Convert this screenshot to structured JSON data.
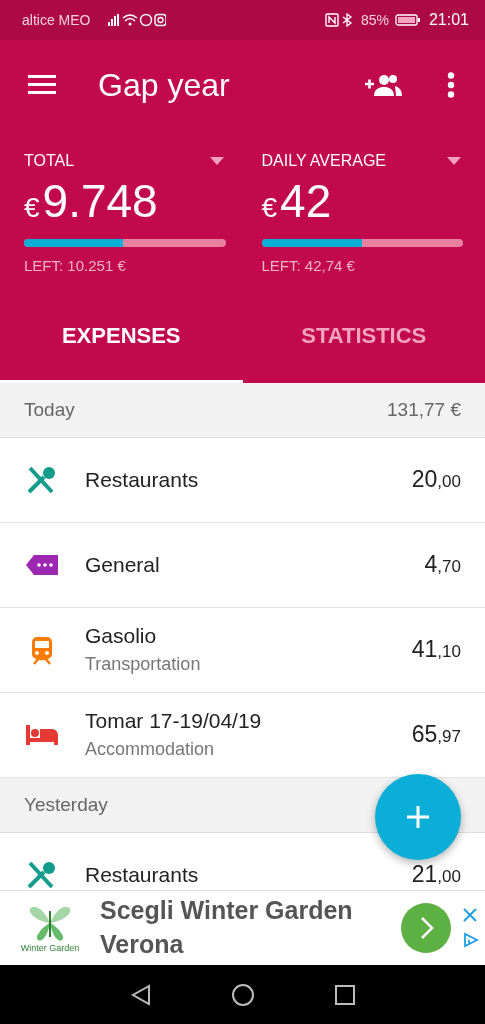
{
  "status_bar": {
    "carrier": "altice MEO",
    "battery": "85%",
    "time": "21:01"
  },
  "toolbar": {
    "title": "Gap year"
  },
  "summary": [
    {
      "label": "TOTAL",
      "currency": "€",
      "value": "9.748",
      "level": 0.49,
      "left": "LEFT: 10.251 €"
    },
    {
      "label": "DAILY AVERAGE",
      "currency": "€",
      "value": "42",
      "level": 0.5,
      "left": "LEFT: 42,74 €"
    }
  ],
  "tabs": [
    {
      "label": "EXPENSES",
      "selected": true
    },
    {
      "label": "STATISTICS",
      "selected": false
    }
  ],
  "sections": [
    {
      "day": "Today",
      "total": "131,77 €",
      "items": [
        {
          "kind": "restaurant",
          "color": "#139c8c",
          "name": "Restaurants",
          "amount": "20",
          "decimals": ",00"
        },
        {
          "kind": "general",
          "color": "#9c27b0",
          "name": "General",
          "amount": "4",
          "decimals": ",70"
        },
        {
          "kind": "transport",
          "color": "#f57c00",
          "name": "Gasolio",
          "category": "Transportation",
          "amount": "41",
          "decimals": ",10"
        },
        {
          "kind": "accommodation",
          "color": "#e53935",
          "name": "Tomar 17-19/04/19",
          "category": "Accommodation",
          "amount": "65",
          "decimals": ",97"
        }
      ]
    },
    {
      "day": "Yesterday",
      "items": [
        {
          "kind": "restaurant",
          "color": "#139c8c",
          "name": "Restaurants",
          "amount": "21",
          "decimals": ",00"
        }
      ]
    }
  ],
  "ad": {
    "logo_caption": "Winter Garden",
    "headline": "Scegli Winter Garden Verona"
  }
}
